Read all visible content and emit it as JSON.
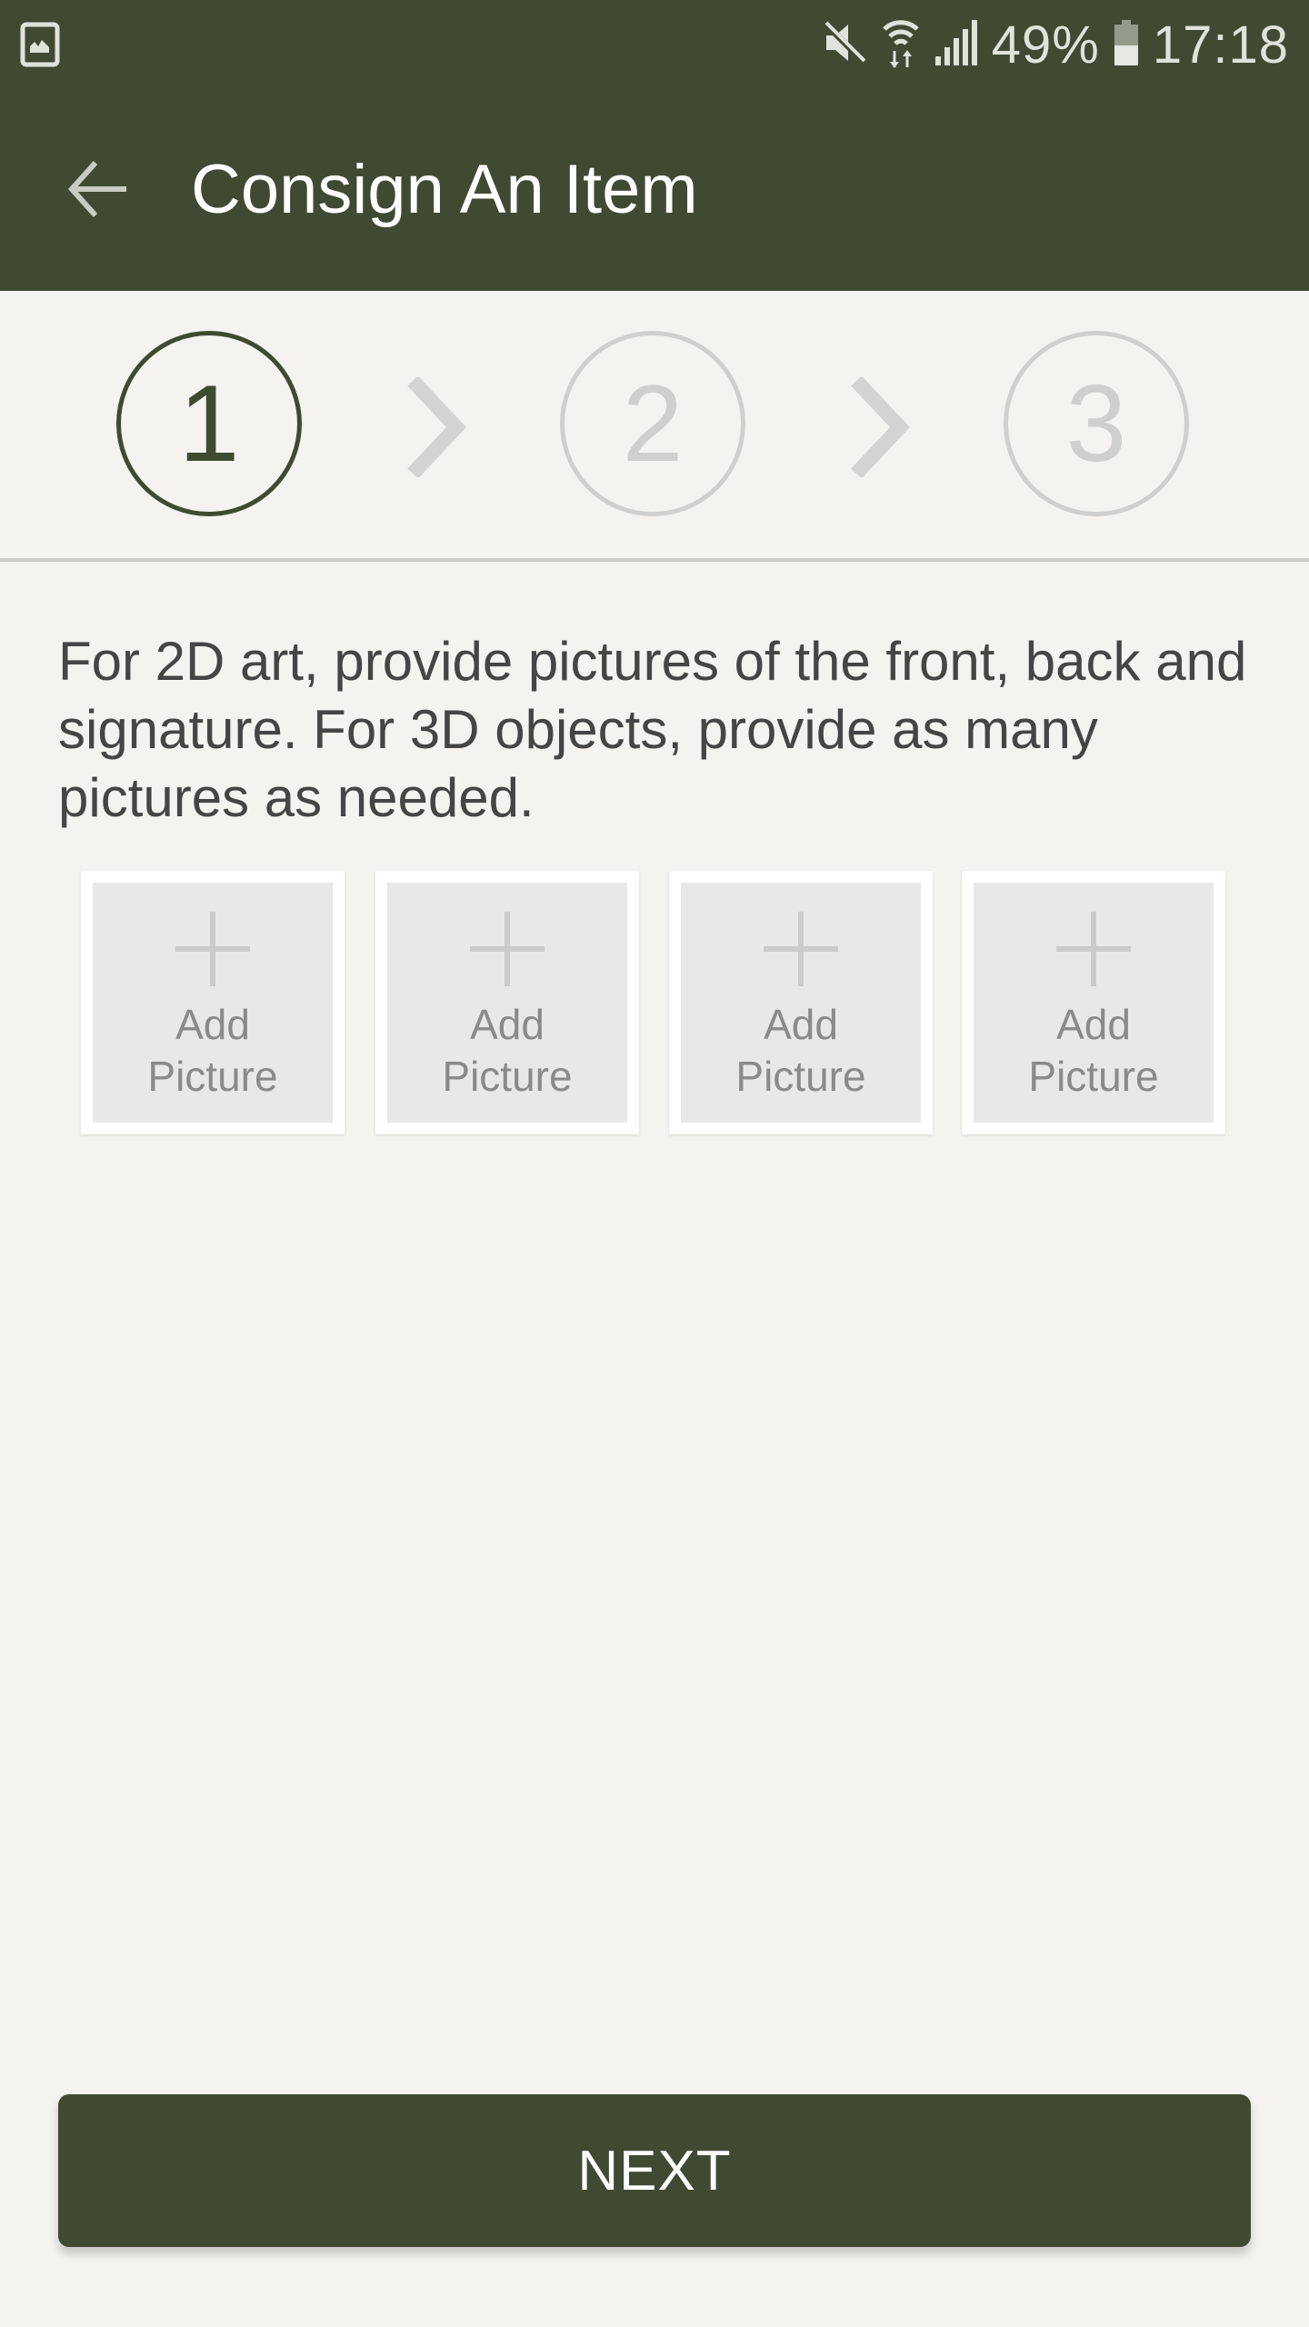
{
  "status_bar": {
    "left_icon": "gallery-notification-icon",
    "icons": [
      "mute-icon",
      "wifi-icon",
      "signal-icon"
    ],
    "battery_percent": "49%",
    "battery_level": 0.49,
    "time": "17:18"
  },
  "app_bar": {
    "back_icon": "arrow-left-icon",
    "title": "Consign An Item"
  },
  "stepper": {
    "steps": [
      {
        "label": "1",
        "state": "active"
      },
      {
        "label": "2",
        "state": "inactive"
      },
      {
        "label": "3",
        "state": "inactive"
      }
    ],
    "separator_icon": "chevron-right-icon"
  },
  "instructions": "For 2D art, provide pictures of the front, back and signature. For 3D objects, provide as many pictures as needed.",
  "picture_slots": [
    {
      "label_line1": "Add",
      "label_line2": "Picture",
      "icon": "plus-icon"
    },
    {
      "label_line1": "Add",
      "label_line2": "Picture",
      "icon": "plus-icon"
    },
    {
      "label_line1": "Add",
      "label_line2": "Picture",
      "icon": "plus-icon"
    },
    {
      "label_line1": "Add",
      "label_line2": "Picture",
      "icon": "plus-icon"
    }
  ],
  "next_button": {
    "label": "NEXT"
  },
  "colors": {
    "primary": "#404a33",
    "background": "#f4f3ef",
    "inactive": "#cfcfcd",
    "text": "#454545"
  }
}
